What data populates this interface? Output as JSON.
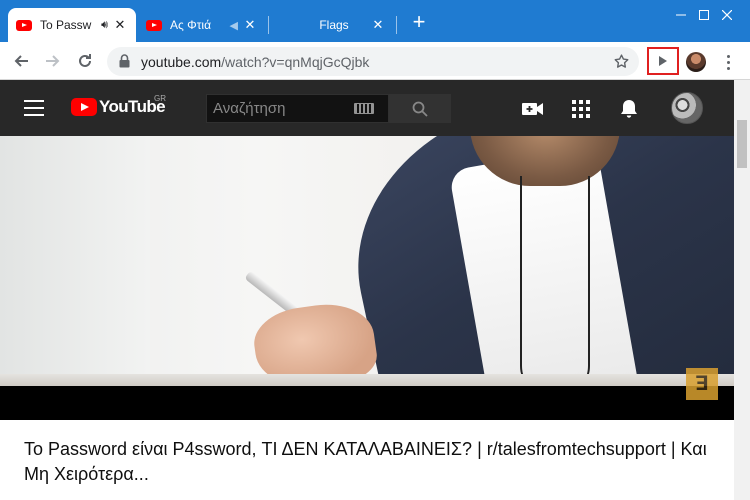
{
  "browser": {
    "tabs": [
      {
        "title": "To Passw",
        "audio_icon": "speaker-icon",
        "active": true
      },
      {
        "title": "Ας Φτιά",
        "audio_icon": "speaker-icon",
        "active": false
      },
      {
        "title": "Flags",
        "active": false
      }
    ],
    "new_tab_label": "+",
    "url_host": "youtube.com",
    "url_path": "/watch?v=qnMqjGcQjbk",
    "colors": {
      "tabstrip": "#1f7bd1",
      "highlight": "#e02020"
    }
  },
  "youtube": {
    "region": "GR",
    "logo_text": "YouTube",
    "search_placeholder": "Αναζήτηση",
    "channel_mark": "Ǝ",
    "video_title": "To Password είναι P4ssword, ΤΙ ΔΕΝ ΚΑΤΑΛΑΒΑΙΝΕΙΣ? | r/talesfromtechsupport | Και Μη Χειρότερα...",
    "colors": {
      "masthead": "#282828",
      "brand": "#ff0000"
    }
  }
}
